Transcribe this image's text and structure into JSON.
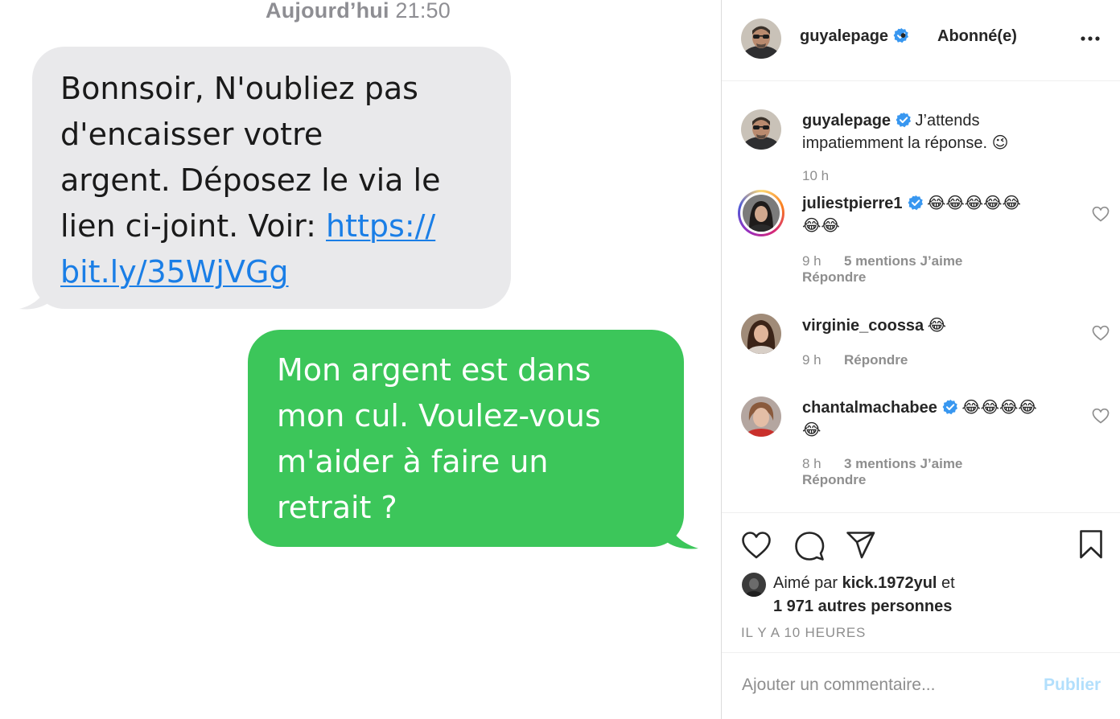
{
  "sms": {
    "timestamp_day": "Aujourd’hui",
    "timestamp_time": "21:50",
    "incoming": {
      "lines": [
        "Bonnsoir, N'oubliez pas",
        "d'encaisser votre",
        "argent. Déposez le via le",
        "lien ci-joint. Voir: "
      ],
      "link_part1": "https://",
      "link_part2": "bit.ly/35WjVGg"
    },
    "outgoing": {
      "lines": [
        "Mon argent est dans",
        "mon cul. Voulez-vous",
        "m'aider à faire un",
        "retrait ?"
      ]
    },
    "colors": {
      "incoming_bubble": "#e9e9eb",
      "outgoing_bubble": "#3cc65a",
      "link": "#1a7ee6"
    }
  },
  "post": {
    "author": "guyalepage",
    "dot": "•",
    "follow_status": "Abonné(e)",
    "caption": {
      "user": "guyalepage",
      "text_line1": "J’attends",
      "text_line2": "impatiemment la réponse. 😉",
      "time": "10 h"
    },
    "comments": [
      {
        "user": "juliestpierre1",
        "verified": true,
        "text_line1": "😂😂😂😂😂",
        "text_line2": "😂😂",
        "time": "9 h",
        "likes": "5 mentions J’aime",
        "reply": "Répondre"
      },
      {
        "user": "virginie_coossa",
        "verified": false,
        "text_line1": "😂",
        "text_line2": "",
        "time": "9 h",
        "likes": "",
        "reply": "Répondre"
      },
      {
        "user": "chantalmachabee",
        "verified": true,
        "text_line1": "😂😂😂😂",
        "text_line2": "😂",
        "time": "8 h",
        "likes": "3 mentions J’aime",
        "reply": "Répondre"
      }
    ],
    "liked_by_prefix": "Aimé par ",
    "liked_by_user": "kick.1972yul",
    "liked_by_suffix": " et",
    "likes_count": "1 971 autres personnes",
    "post_time": "IL Y A 10 HEURES",
    "comment_placeholder": "Ajouter un commentaire...",
    "publish_label": "Publier",
    "icons": {
      "more": "more-options-icon",
      "like": "heart-icon",
      "comment": "comment-icon",
      "share": "share-icon",
      "save": "bookmark-icon",
      "verified": "verified-badge-icon"
    },
    "colors": {
      "verified": "#3897f0",
      "publish_disabled": "#b2dffc",
      "meta": "#8e8e8e"
    }
  }
}
